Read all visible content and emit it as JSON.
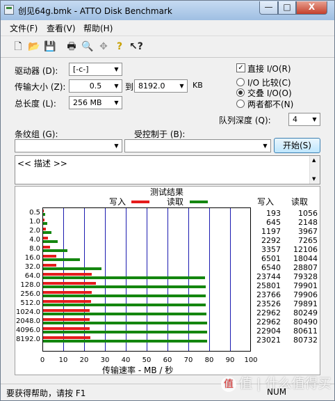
{
  "window": {
    "title": "创见64g.bmk - ATTO Disk Benchmark",
    "min": "—",
    "max": "□",
    "close": "X"
  },
  "menu": [
    "文件(F)",
    "查看(V)",
    "帮助(H)"
  ],
  "toolbar": [
    "new-file-icon",
    "open-folder-icon",
    "save-icon",
    "print-icon",
    "print-preview-icon",
    "move-icon",
    "help-icon",
    "context-help-icon"
  ],
  "form": {
    "drive_label": "驱动器 (D):",
    "drive_value": "[-c-]",
    "transfer_label": "传输大小 (Z):",
    "transfer_from": "0.5",
    "to_label": "到",
    "transfer_to": "8192.0",
    "kb_label": "KB",
    "total_label": "总长度 (L):",
    "total_value": "256 MB",
    "direct_io_label": "直接 I/O(R)",
    "direct_io_checked": true,
    "io_compare_label": "I/O 比较(C)",
    "overlap_io_label": "交叠 I/O(O)",
    "neither_label": "两者都不(N)",
    "queue_label": "队列深度 (Q):",
    "queue_value": "4",
    "stripe_label": "条纹组 (G):",
    "controlled_label": "受控制于 (B):",
    "start_button": "开始(S)",
    "description": "<< 描述 >>"
  },
  "chart_data": {
    "type": "bar",
    "title": "测试结果",
    "xlabel": "传输速率 - MB / 秒",
    "xlim": [
      0,
      100
    ],
    "xticks": [
      "0",
      "10",
      "20",
      "30",
      "40",
      "50",
      "60",
      "70",
      "80",
      "90",
      "100"
    ],
    "categories": [
      "0.5",
      "1.0",
      "2.0",
      "4.0",
      "8.0",
      "16.0",
      "32.0",
      "64.0",
      "128.0",
      "256.0",
      "512.0",
      "1024.0",
      "2048.0",
      "4096.0",
      "8192.0"
    ],
    "series": [
      {
        "name": "写入",
        "color": "#e51c1c",
        "values": [
          0.2,
          0.6,
          1.2,
          2.2,
          3.3,
          6.3,
          6.4,
          23.2,
          25.2,
          23.2,
          23.0,
          22.4,
          22.4,
          22.4,
          22.5
        ]
      },
      {
        "name": "读取",
        "color": "#14860f",
        "values": [
          1.0,
          2.1,
          3.9,
          7.1,
          11.8,
          17.6,
          28.1,
          77.5,
          78.0,
          78.0,
          77.9,
          78.4,
          78.6,
          78.7,
          78.8
        ]
      }
    ],
    "table_headers": [
      "写入",
      "读取"
    ],
    "table": [
      [
        "193",
        "1056"
      ],
      [
        "645",
        "2148"
      ],
      [
        "1197",
        "3967"
      ],
      [
        "2292",
        "7265"
      ],
      [
        "3357",
        "12106"
      ],
      [
        "6501",
        "18044"
      ],
      [
        "6540",
        "28807"
      ],
      [
        "23744",
        "79328"
      ],
      [
        "25801",
        "79901"
      ],
      [
        "23766",
        "79906"
      ],
      [
        "23526",
        "79891"
      ],
      [
        "22962",
        "80249"
      ],
      [
        "22962",
        "80490"
      ],
      [
        "22904",
        "80611"
      ],
      [
        "23021",
        "80732"
      ]
    ]
  },
  "status": {
    "help_text": "要获得帮助，请按 F1",
    "indicator": "NUM"
  },
  "watermark": "值 | 什么值得买"
}
